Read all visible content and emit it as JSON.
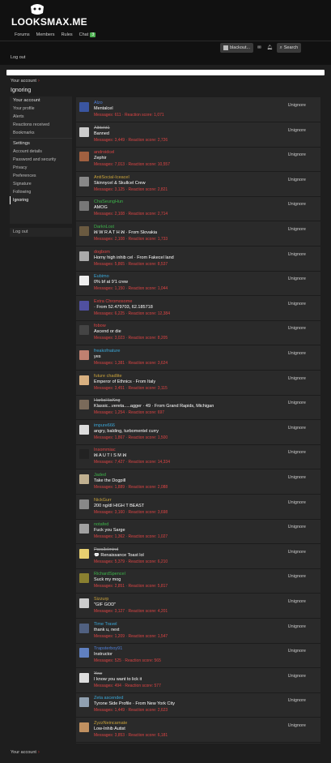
{
  "header": {
    "logo": "LOOKSMAX.ME",
    "nav": [
      "Forums",
      "Members",
      "Rules",
      "Chat"
    ],
    "chat_badge": "3",
    "username": "blackout...",
    "search": "Search"
  },
  "logout_top": "Log out",
  "breadcrumb": "Your account",
  "page_title": "Ignoring",
  "sidebar": {
    "group1": [
      "Your account",
      "Your profile",
      "Alerts",
      "Reactions received",
      "Bookmarks"
    ],
    "settings_head": "Settings",
    "group2": [
      "Account details",
      "Password and security",
      "Privacy",
      "Preferences",
      "Signature",
      "Following",
      "Ignoring"
    ],
    "logout": "Log out"
  },
  "unignore_label": "Unignore",
  "users": [
    {
      "name": "Alzo",
      "title": "Mentalcel",
      "messages": "611",
      "reactions": "1,071",
      "color": "#4f7fd8",
      "av": "#3a55a0"
    },
    {
      "name": "Altitekt1",
      "title": "Banned",
      "messages": "3,449",
      "reactions": "2,726",
      "color": "#aaa",
      "av": "#ccc",
      "strike": true
    },
    {
      "name": "androidcel",
      "title": "Zephir",
      "messages": "7,013",
      "reactions": "10,557",
      "color": "#d44",
      "av": "#a06040"
    },
    {
      "name": "AntiSocial-Iceacel",
      "title": "Skinnycel & Skullcel Crew",
      "messages": "3,125",
      "reactions": "2,821",
      "color": "#c9a23a",
      "av": "#888"
    },
    {
      "name": "ChaSeungHun",
      "title": "AMOG",
      "messages": "2,108",
      "reactions": "2,714",
      "color": "#3db34a",
      "av": "#777"
    },
    {
      "name": "DarknLost",
      "title": "ꟽ W R A T H ꟽ · From Slovakia",
      "messages": "2,108",
      "reactions": "1,733",
      "color": "#3db34a",
      "av": "#6a5a40"
    },
    {
      "name": "dogbom",
      "title": "Horny high inhib cel · From Fakecel land",
      "messages": "5,865",
      "reactions": "8,537",
      "color": "#d44",
      "av": "#aaa"
    },
    {
      "name": "Eubimo",
      "title": "0% bf at 9'1 crew",
      "messages": "1,150",
      "reactions": "1,044",
      "color": "#3aa7d8",
      "av": "#eee"
    },
    {
      "name": "Extra Chromosome",
      "title": "· From 52.479703, 62.185718",
      "messages": "6,225",
      "reactions": "12,384",
      "color": "#d44",
      "av": "#5050a0"
    },
    {
      "name": "fobow",
      "title": "Ascend or die",
      "messages": "3,023",
      "reactions": "8,205",
      "color": "#d44",
      "av": "#444"
    },
    {
      "name": "freakofnature",
      "title": "yes",
      "messages": "1,381",
      "reactions": "3,624",
      "color": "#3aa7d8",
      "av": "#c08070"
    },
    {
      "name": "future chadlite",
      "title": "Emperor of Ethnics · From Italy",
      "messages": "3,451",
      "reactions": "3,115",
      "color": "#c9a23a",
      "av": "#d8b080"
    },
    {
      "name": "HarliaHiaKng",
      "title": "Klassic...vereta.....agger · 49 · From Grand Rapids, Michigan",
      "messages": "1,254",
      "reactions": "697",
      "color": "#aaa",
      "av": "#7a6a5a",
      "strike": true
    },
    {
      "name": "impure666",
      "title": "angry, balding, turbomentel curry",
      "messages": "1,867",
      "reactions": "1,500",
      "color": "#3aa7d8",
      "av": "#ddd"
    },
    {
      "name": "Insommiac",
      "title": "ꟽ A U T I S M ꟽ",
      "messages": "7,427",
      "reactions": "14,334",
      "color": "#d44",
      "av": "#222"
    },
    {
      "name": "Jaded",
      "title": "Take the Dogpill",
      "messages": "1,889",
      "reactions": "2,088",
      "color": "#3db34a",
      "av": "#c0b090"
    },
    {
      "name": "NickGurr",
      "title": "200 ng/dl HIGH T BEAST",
      "messages": "3,160",
      "reactions": "3,698",
      "color": "#c9a23a",
      "av": "#888"
    },
    {
      "name": "notafed",
      "title": "Fuck you Sarge",
      "messages": "1,362",
      "reactions": "1,027",
      "color": "#3db34a",
      "av": "#a0a0a0"
    },
    {
      "name": "Parallelmind",
      "title": "💬 Renaissance Toast lol",
      "messages": "5,379",
      "reactions": "6,210",
      "color": "#aaa",
      "av": "#e8d070",
      "strike": true
    },
    {
      "name": "RichardSpencel",
      "title": "Suck my mog",
      "messages": "2,851",
      "reactions": "5,817",
      "color": "#3db34a",
      "av": "#8a8030"
    },
    {
      "name": "Sizzurp",
      "title": "\"GIF GOD\"",
      "messages": "3,127",
      "reactions": "4,201",
      "color": "#c9a23a",
      "av": "#ccc"
    },
    {
      "name": "Time Travel",
      "title": "thank u, next",
      "messages": "1,209",
      "reactions": "1,547",
      "color": "#3aa7d8",
      "av": "#506080"
    },
    {
      "name": "Trapsterboy91",
      "title": "Instructor",
      "messages": "525",
      "reactions": "565",
      "color": "#4f7fd8",
      "av": "#6080c0"
    },
    {
      "name": "Yew",
      "title": "I know you want to lick it",
      "messages": "494",
      "reactions": "577",
      "color": "#aaa",
      "av": "#ddd",
      "strike": true
    },
    {
      "name": "Zeta ascended",
      "title": "Tyrone Side Profile · From New York City",
      "messages": "1,449",
      "reactions": "2,623",
      "color": "#3aa7d8",
      "av": "#90a0b0"
    },
    {
      "name": "ZyzzNeincarnate",
      "title": "Low-Inhib Autist",
      "messages": "3,853",
      "reactions": "6,181",
      "color": "#c9a23a",
      "av": "#c09060"
    }
  ],
  "stats_labels": {
    "messages": "Messages:",
    "reactions": "Reaction score:"
  },
  "footer_breadcrumb": "Your account"
}
